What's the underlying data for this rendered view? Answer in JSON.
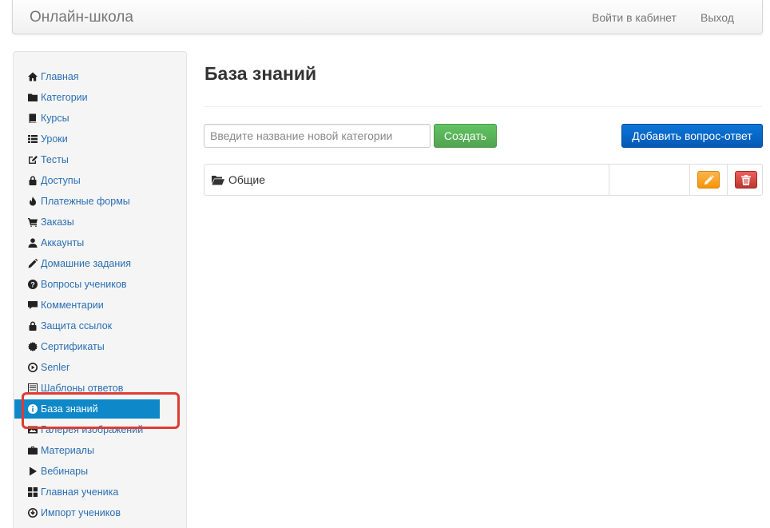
{
  "navbar": {
    "brand": "Онлайн-школа",
    "login": "Войти в кабинет",
    "logout": "Выход"
  },
  "sidebar": {
    "items": [
      {
        "label": "Главная",
        "icon": "home-icon"
      },
      {
        "label": "Категории",
        "icon": "folder-icon"
      },
      {
        "label": "Курсы",
        "icon": "book-icon"
      },
      {
        "label": "Уроки",
        "icon": "list-icon"
      },
      {
        "label": "Тесты",
        "icon": "edit-icon"
      },
      {
        "label": "Доступы",
        "icon": "lock-icon"
      },
      {
        "label": "Платежные формы",
        "icon": "fire-icon"
      },
      {
        "label": "Заказы",
        "icon": "cart-icon"
      },
      {
        "label": "Аккаунты",
        "icon": "user-icon"
      },
      {
        "label": "Домашние задания",
        "icon": "pencil-icon"
      },
      {
        "label": "Вопросы учеников",
        "icon": "question-icon"
      },
      {
        "label": "Комментарии",
        "icon": "comment-icon"
      },
      {
        "label": "Защита ссылок",
        "icon": "lock-icon"
      },
      {
        "label": "Сертификаты",
        "icon": "certificate-icon"
      },
      {
        "label": "Senler",
        "icon": "play-circle-icon"
      },
      {
        "label": "Шаблоны ответов",
        "icon": "list-alt-icon"
      },
      {
        "label": "База знаний",
        "icon": "info-icon",
        "active": true
      },
      {
        "label": "Галерея изображений",
        "icon": "picture-icon"
      },
      {
        "label": "Материалы",
        "icon": "briefcase-icon"
      },
      {
        "label": "Вебинары",
        "icon": "play-icon"
      },
      {
        "label": "Главная ученика",
        "icon": "th-large-icon"
      },
      {
        "label": "Импорт учеников",
        "icon": "import-icon"
      }
    ]
  },
  "main": {
    "title": "База знаний",
    "category_input": {
      "placeholder": "Введите название новой категории",
      "value": ""
    },
    "create_label": "Создать",
    "add_qa_label": "Добавить вопрос-ответ",
    "categories": [
      {
        "name": "Общие",
        "icon": "folder-open-icon"
      }
    ]
  },
  "colors": {
    "active_item": "#0e88c8",
    "link": "#2a6fb3",
    "create_button": "#5cb85c",
    "add_button": "#0862c7",
    "edit_button": "#f89406",
    "delete_button": "#d9534f",
    "highlight": "#e03b32"
  }
}
